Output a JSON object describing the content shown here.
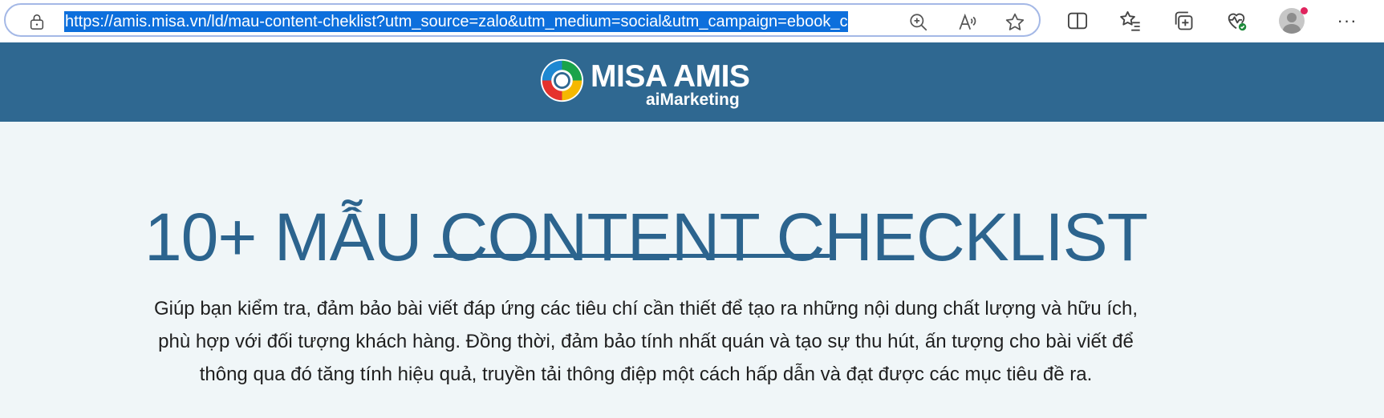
{
  "browser": {
    "url": "https://amis.misa.vn/ld/mau-content-cheklist?utm_source=zalo&utm_medium=social&utm_campaign=ebook_c",
    "icons": [
      "lock-icon",
      "zoom-icon",
      "read-aloud-icon",
      "favorite-star-icon",
      "split-screen-icon",
      "favorites-list-icon",
      "collections-icon",
      "browser-essentials-icon",
      "profile-avatar",
      "more-icon"
    ],
    "more_label": "···"
  },
  "site": {
    "logo_name": "MISA AMIS",
    "logo_sub": "aiMarketing",
    "header_color": "#2f6891"
  },
  "hero": {
    "title": "10+ MẪU CONTENT CHECKLIST",
    "title_color": "#2c648e",
    "description_lines": [
      "Giúp bạn kiểm tra, đảm bảo bài viết đáp ứng các tiêu chí cần thiết để tạo ra những nội dung chất lượng và hữu ích,",
      "phù hợp với đối tượng khách hàng. Đồng thời, đảm bảo tính nhất quán và tạo sự thu hút, ấn tượng cho bài viết để",
      "thông qua đó tăng tính hiệu quả, truyền tải thông điệp một cách hấp dẫn và đạt được các mục tiêu đề ra."
    ]
  }
}
